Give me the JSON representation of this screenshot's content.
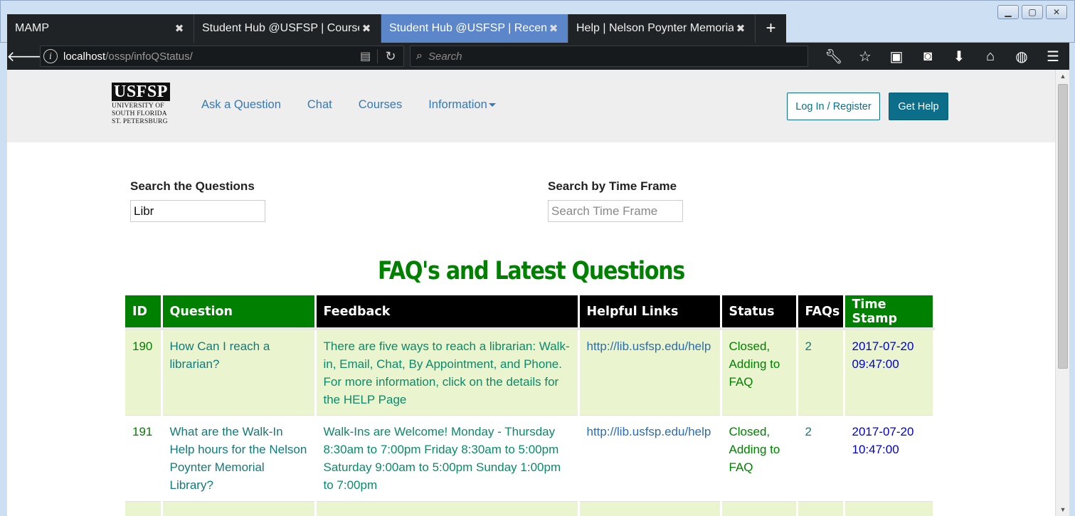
{
  "browser": {
    "tabs": [
      {
        "title": "MAMP",
        "active": false
      },
      {
        "title": "Student Hub @USFSP | Courses",
        "active": false
      },
      {
        "title": "Student Hub @USFSP | Recent Qu",
        "active": true
      },
      {
        "title": "Help | Nelson Poynter Memorial L",
        "active": false
      }
    ],
    "new_tab": "+",
    "close_glyph": "✖",
    "url_host": "localhost",
    "url_path": "/ossp/infoQStatus/",
    "search_placeholder": "Search"
  },
  "site": {
    "logo_mark": "USFSP",
    "logo_line1": "UNIVERSITY OF",
    "logo_line2": "SOUTH FLORIDA",
    "logo_line3": "ST. PETERSBURG",
    "nav": {
      "ask": "Ask a Question",
      "chat": "Chat",
      "courses": "Courses",
      "information": "Information"
    },
    "login_label": "Log In / Register",
    "help_label": "Get Help"
  },
  "search": {
    "questions_label": "Search the Questions",
    "questions_value": "Libr",
    "timeframe_label": "Search by Time Frame",
    "timeframe_placeholder": "Search Time Frame"
  },
  "faq": {
    "title": "FAQ's and Latest Questions",
    "headers": {
      "id": "ID",
      "question": "Question",
      "feedback": "Feedback",
      "links": "Helpful Links",
      "status": "Status",
      "faqs": "FAQs",
      "timestamp": "Time Stamp"
    },
    "rows": [
      {
        "id": "190",
        "question": "How Can I reach a librarian?",
        "feedback": "There are five ways to reach a librarian: Walk-in, Email, Chat, By Appointment, and Phone. For more information, click on the details for the HELP Page",
        "link": "http://lib.usfsp.edu/help",
        "status": "Closed, Adding to FAQ",
        "faqs": "2",
        "timestamp": "2017-07-20 09:47:00"
      },
      {
        "id": "191",
        "question": "What are the Walk-In Help hours for the Nelson Poynter Memorial Library?",
        "feedback": "Walk-Ins are Welcome! Monday - Thursday 8:30am to 7:00pm Friday 8:30am to 5:00pm Saturday 9:00am to 5:00pm Sunday 1:00pm to 7:00pm",
        "link": "http://lib.usfsp.edu/help",
        "status": "Closed, Adding to FAQ",
        "faqs": "2",
        "timestamp": "2017-07-20 10:47:00"
      }
    ]
  },
  "colors": {
    "accent_green": "#008000",
    "header_black": "#000000",
    "row_tint": "#eaf5d0",
    "button_teal": "#0d6e8a",
    "active_tab": "#5b86c9"
  }
}
